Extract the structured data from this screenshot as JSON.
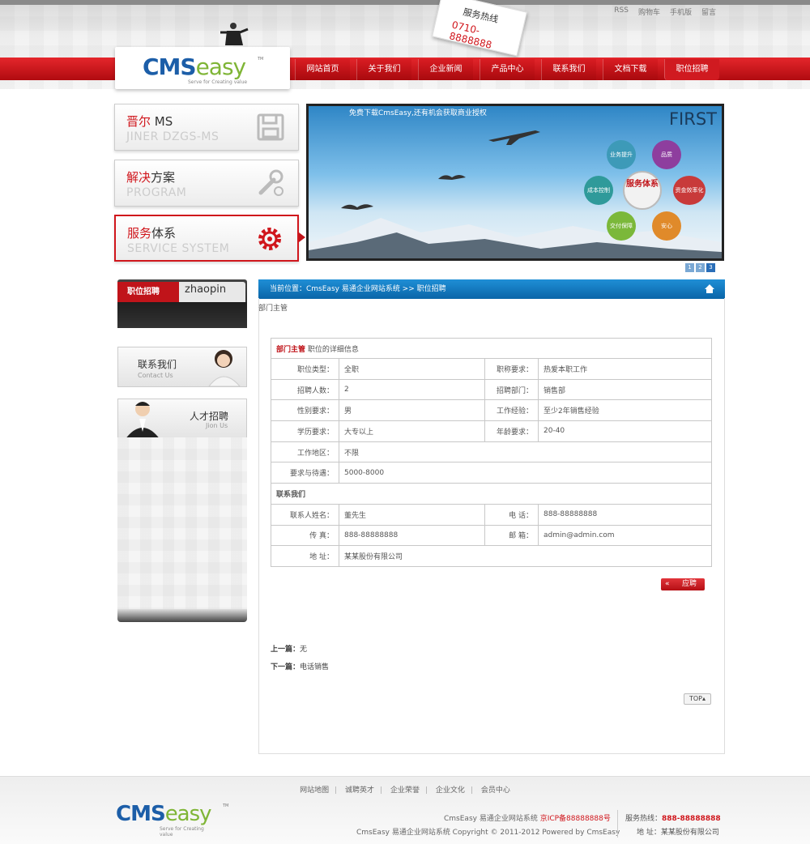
{
  "top_links": [
    "RSS",
    "购物车",
    "手机版",
    "留言"
  ],
  "hotline": {
    "label": "服务热线",
    "number": "0710-8888888"
  },
  "logo": {
    "cms": "CMS",
    "easy": "easy",
    "tm": "TM",
    "tagline": "Serve for Creating value"
  },
  "nav": [
    "网站首页",
    "关于我们",
    "企业新闻",
    "产品中心",
    "联系我们",
    "文档下载",
    "职位招聘"
  ],
  "side_buttons": [
    {
      "red": "晋尔",
      "rest": " MS",
      "en": "JINER DZGS-MS"
    },
    {
      "red": "解决",
      "rest": "方案",
      "en": "PROGRAM"
    },
    {
      "red": "服务",
      "rest": "体系",
      "en": "SERVICE SYSTEM"
    }
  ],
  "banner": {
    "caption": "免费下载CmsEasy,还有机会获取商业授权",
    "first": "FIRST",
    "hexes": [
      "业务提升",
      "品质",
      "资金效率化",
      "安心",
      "交付保障",
      "成本控制"
    ],
    "center": "服务体系",
    "dots": [
      "1",
      "2",
      "3"
    ]
  },
  "zhaopin": {
    "cn": "职位招聘",
    "en": "zhaopin"
  },
  "contact_us": {
    "cn": "联系我们",
    "en": "Contact Us"
  },
  "join_us": {
    "cn": "人才招聘",
    "en": "Jion Us"
  },
  "breadcrumb": "当前位置：CmsEasy 易通企业网站系统 >> 职位招聘",
  "category_label": "部门主管",
  "job": {
    "title": "部门主管",
    "subtitle": "职位的详细信息",
    "rows": [
      {
        "l1": "职位类型：",
        "v1": "全职",
        "l2": "职称要求：",
        "v2": "热爱本职工作"
      },
      {
        "l1": "招聘人数：",
        "v1": "2",
        "l2": "招聘部门：",
        "v2": "销售部"
      },
      {
        "l1": "性别要求：",
        "v1": "男",
        "l2": "工作经验：",
        "v2": "至少2年销售经验"
      },
      {
        "l1": "学历要求：",
        "v1": "大专以上",
        "l2": "年龄要求：",
        "v2": "20-40"
      }
    ],
    "area_label": "工作地区：",
    "area": "不限",
    "salary_label": "要求与待遇：",
    "salary": "5000-8000",
    "contact_heading": "联系我们",
    "contact_rows": [
      {
        "l1": "联系人姓名：",
        "v1": "董先生",
        "l2": "电 话：",
        "v2": "888-88888888"
      },
      {
        "l1": "传 真：",
        "v1": "888-88888888",
        "l2": "邮 箱：",
        "v2": "admin@admin.com"
      }
    ],
    "address_label": "地 址：",
    "address": "某某股份有限公司"
  },
  "apply_label": "应聘",
  "prev": {
    "label": "上一篇：",
    "value": "无"
  },
  "next": {
    "label": "下一篇：",
    "value": "电话销售"
  },
  "top_label": "TOP",
  "footer": {
    "links": [
      "网站地图",
      "诚聘英才",
      "企业荣誉",
      "企业文化",
      "会员中心"
    ],
    "line1_a": "CmsEasy 易通企业网站系统 ",
    "icp": "京ICP备88888888号",
    "line2": "CmsEasy 易通企业网站系统 Copyright © 2011-2012 Powered by CmsEasy",
    "hotline_label": "服务热线：",
    "hotline": "888-88888888",
    "address": "地 址：某某股份有限公司"
  }
}
